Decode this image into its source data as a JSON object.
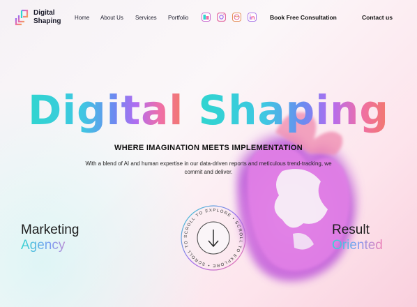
{
  "brand": {
    "name_line1": "Digital",
    "name_line2": "Shaping",
    "logo_icon": "brand-logo-icon"
  },
  "nav": {
    "items": [
      "Home",
      "About Us",
      "Services",
      "Portfolio"
    ]
  },
  "social": [
    {
      "icon": "behance-icon",
      "color": "#c86bd0"
    },
    {
      "icon": "instagram-icon",
      "color": "#e36aa2"
    },
    {
      "icon": "dribbble-icon",
      "color": "#e48c56"
    },
    {
      "icon": "linkedin-icon",
      "color": "#a978e8"
    }
  ],
  "header_actions": {
    "consult": "Book Free Consultation",
    "contact": "Contact us"
  },
  "hero": {
    "title_part1": "Digital",
    "title_part2": "Shaping",
    "tagline": "WHERE IMAGINATION MEETS IMPLEMENTATION",
    "description": "With a blend of AI and human expertise in our data-driven reports and meticulous trend-tracking, we commit and deliver."
  },
  "left_label": {
    "line1": "Marketing",
    "line2": "Agency"
  },
  "right_label": {
    "line1": "Result",
    "line2": "Oriented"
  },
  "scroll": {
    "text": "SCROLL TO EXPLORE • SCROLL TO EXPLORE • SCROLL TO EXPLORE • ",
    "icon": "arrow-down-icon"
  },
  "colors": {
    "teal": "#2fd5cf",
    "purple": "#9b6cf0",
    "pink": "#ef6fa8",
    "coral": "#f2796a"
  }
}
